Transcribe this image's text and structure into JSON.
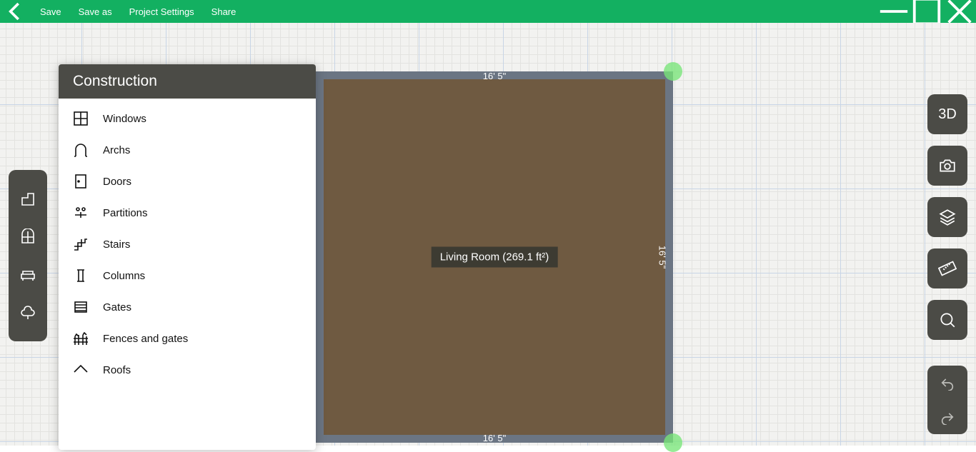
{
  "topbar": {
    "menu": [
      "Save",
      "Save as",
      "Project Settings",
      "Share"
    ]
  },
  "panel": {
    "title": "Construction",
    "items": [
      {
        "label": "Windows",
        "icon": "windows-icon"
      },
      {
        "label": "Archs",
        "icon": "arch-icon"
      },
      {
        "label": "Doors",
        "icon": "door-icon"
      },
      {
        "label": "Partitions",
        "icon": "partition-icon"
      },
      {
        "label": "Stairs",
        "icon": "stairs-icon"
      },
      {
        "label": "Columns",
        "icon": "column-icon"
      },
      {
        "label": "Gates",
        "icon": "gate-icon"
      },
      {
        "label": "Fences and gates",
        "icon": "fence-icon"
      },
      {
        "label": "Roofs",
        "icon": "roof-icon"
      }
    ]
  },
  "room": {
    "name_area": "Living Room (269.1 ft²)",
    "dim_top": "16' 5\"",
    "dim_bottom": "16' 5\"",
    "dim_right": "16' 5\""
  },
  "right_tools": {
    "view3d": "3D"
  }
}
